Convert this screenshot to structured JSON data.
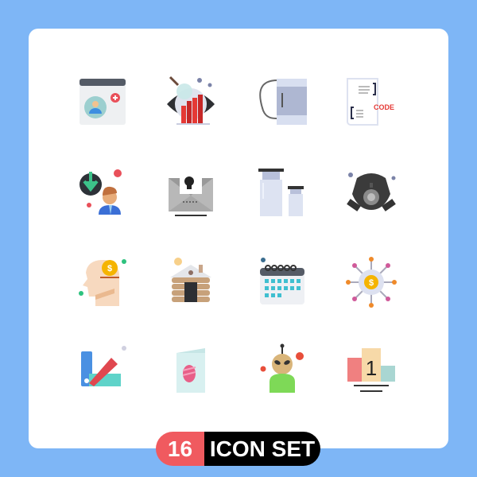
{
  "icons": [
    {
      "name": "browser-user-add-icon"
    },
    {
      "name": "eye-analytics-search-icon"
    },
    {
      "name": "mug-icon"
    },
    {
      "name": "code-document-icon",
      "text": "CODE"
    },
    {
      "name": "user-download-icon"
    },
    {
      "name": "skull-email-icon"
    },
    {
      "name": "medicine-bottles-icon"
    },
    {
      "name": "gas-mask-icon"
    },
    {
      "name": "head-money-icon",
      "text": "$"
    },
    {
      "name": "log-cabin-icon"
    },
    {
      "name": "calendar-icon"
    },
    {
      "name": "money-network-icon",
      "text": "$"
    },
    {
      "name": "color-swatch-icon"
    },
    {
      "name": "easter-egg-card-icon"
    },
    {
      "name": "alien-icon"
    },
    {
      "name": "podium-ranking-icon",
      "text": "1"
    }
  ],
  "badge": {
    "count": "16",
    "label": "ICON SET"
  },
  "colors": {
    "background": "#7eb6f6",
    "card": "#ffffff",
    "badge_red": "#f05a5f",
    "badge_black": "#000000"
  }
}
